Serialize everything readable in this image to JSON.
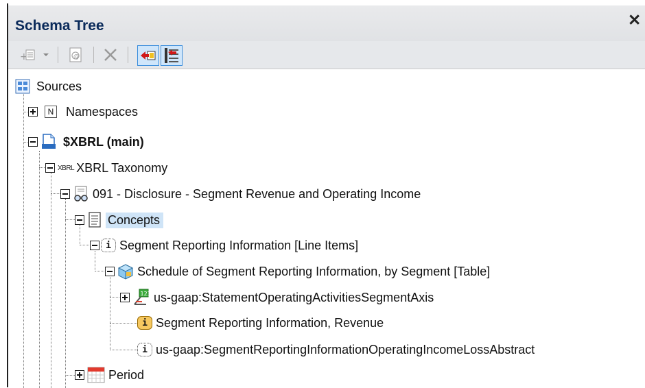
{
  "panel": {
    "title": "Schema Tree",
    "close_label": "✕"
  },
  "toolbar": [
    {
      "icon": "add-element-icon",
      "label": "⊕"
    },
    {
      "icon": "dropdown-icon"
    },
    {
      "icon": "function-icon"
    },
    {
      "icon": "delete-icon"
    },
    {
      "icon": "collapse-left-icon",
      "active": true
    },
    {
      "icon": "tree-nav-icon",
      "active": true
    }
  ],
  "tree": {
    "sources": "Sources",
    "namespaces": "Namespaces",
    "namespaces_badge": "N",
    "main": "$XBRL (main)",
    "taxonomy_prefix": "XBRL",
    "taxonomy": "XBRL Taxonomy",
    "disclosure": "091 - Disclosure - Segment Revenue and Operating Income",
    "concepts": "Concepts",
    "line_items": "Segment Reporting Information [Line Items]",
    "table": "Schedule of Segment Reporting Information, by Segment [Table]",
    "axis": "us-gaap:StatementOperatingActivitiesSegmentAxis",
    "revenue": "Segment Reporting Information, Revenue",
    "abstract": "us-gaap:SegmentReportingInformationOperatingIncomeLossAbstract",
    "period": "Period",
    "info_badge": "i"
  }
}
